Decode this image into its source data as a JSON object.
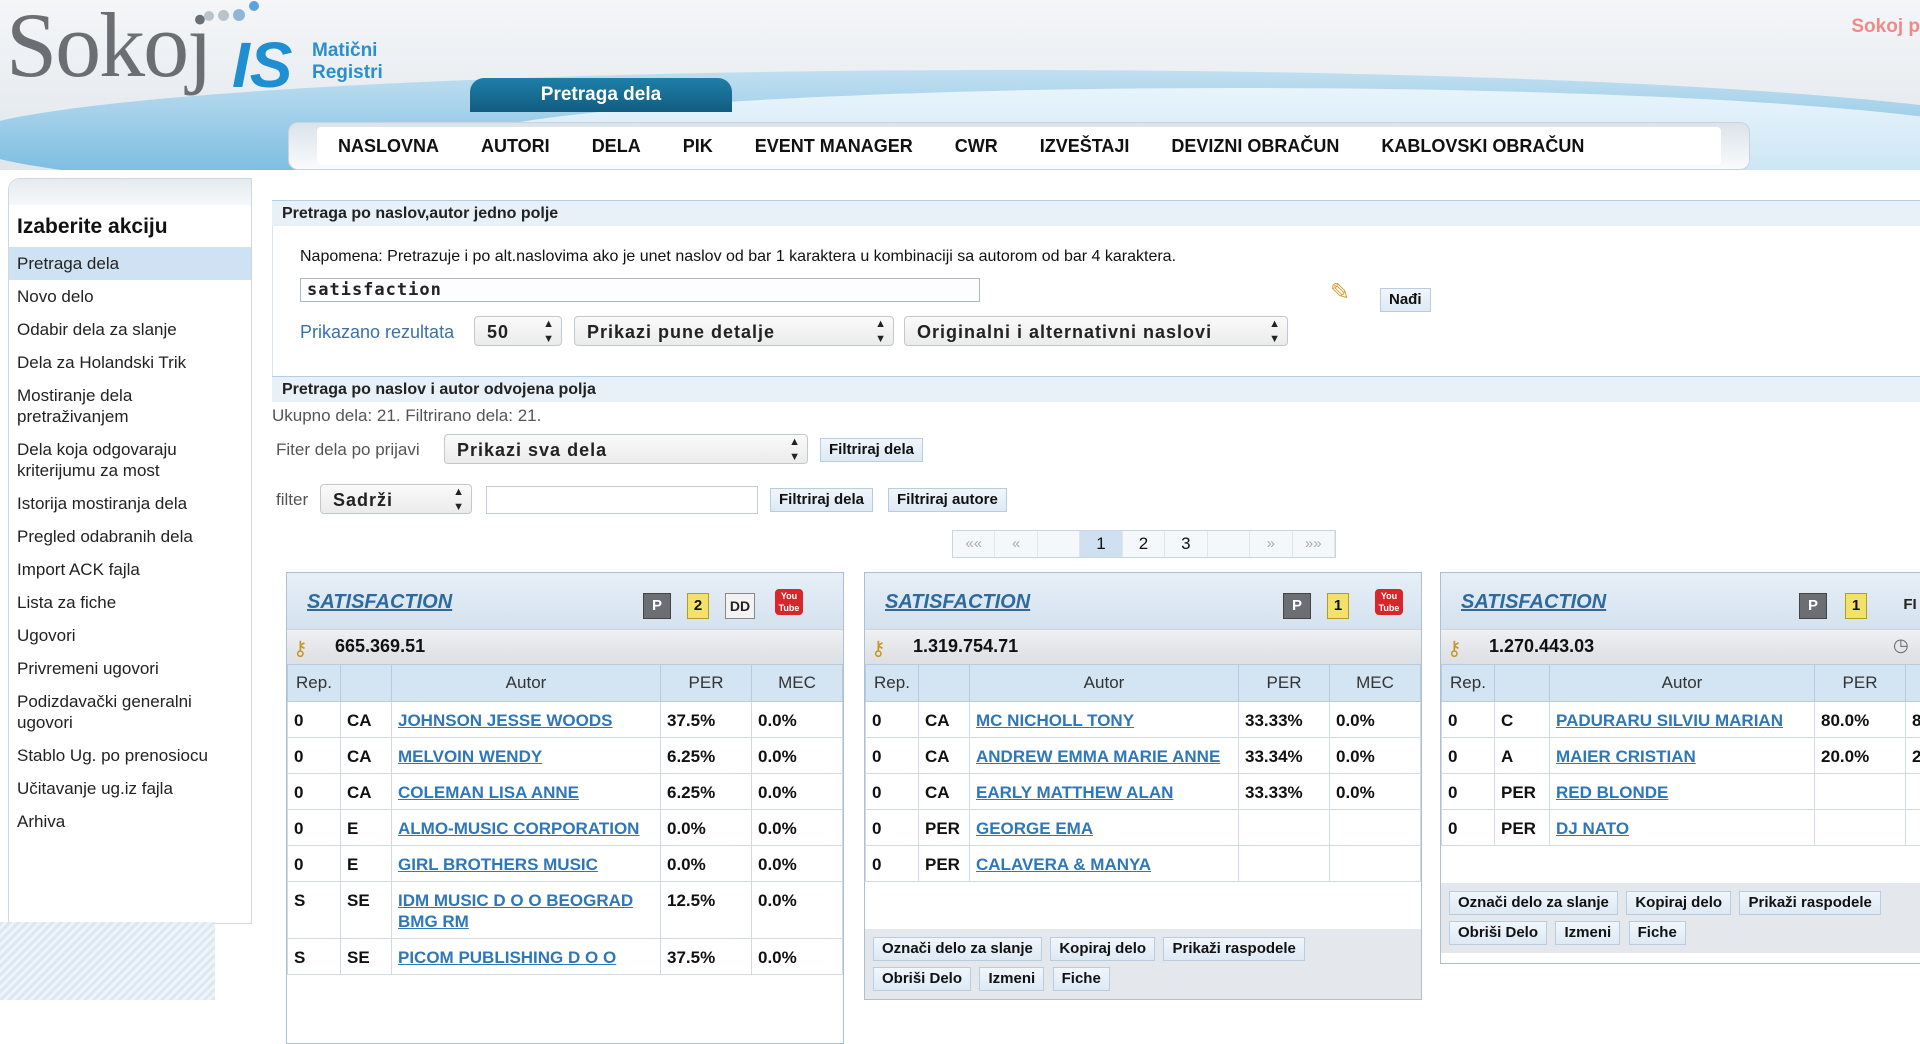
{
  "header": {
    "logo_text": "Sokoj",
    "logo_is": "IS",
    "logo_sub1": "Matični",
    "logo_sub2": "Registri",
    "top_right": "Sokoj p",
    "active_tab": "Pretraga dela"
  },
  "nav": [
    "NASLOVNA",
    "AUTORI",
    "DELA",
    "PIK",
    "EVENT MANAGER",
    "CWR",
    "IZVEŠTAJI",
    "DEVIZNI OBRAČUN",
    "KABLOVSKI OBRAČUN"
  ],
  "sidebar": {
    "title": "Izaberite akciju",
    "items": [
      "Pretraga dela",
      "Novo delo",
      "Odabir dela za slanje",
      "Dela za Holandski Trik",
      "Mostiranje dela pretraživanjem",
      "Dela koja odgovaraju kriterijumu za most",
      "Istorija mostiranja dela",
      "Pregled odabranih dela",
      "Import ACK fajla",
      "Lista za fiche",
      "Ugovori",
      "Privremeni ugovori",
      "Podizdavački generalni ugovori",
      "Stablo Ug. po prenosiocu",
      "Učitavanje ug.iz fajla",
      "Arhiva"
    ]
  },
  "search1": {
    "section_title": "Pretraga po naslov,autor jedno polje",
    "note": "Napomena: Pretrazuje i po alt.naslovima ako je unet naslov od bar 1 karaktera u kombinaciji sa autorom od bar 4 karaktera.",
    "query": "satisfaction",
    "find_button": "Nađi",
    "results_label": "Prikazano rezultata",
    "results_count": "50",
    "detail_select": "Prikazi pune detalje",
    "titles_select": "Originalni i alternativni naslovi"
  },
  "search2": {
    "section_title": "Pretraga po naslov i autor odvojena polja",
    "totals": "Ukupno dela: 21. Filtrirano dela: 21.",
    "filter_prijavi_label": "Fiter dela po prijavi",
    "filter_prijavi_value": "Prikazi sva dela",
    "filter_button": "Filtriraj dela",
    "filter_label": "filter",
    "filter_mode": "Sadrži",
    "filter_input_value": "",
    "filter_works_button": "Filtriraj dela",
    "filter_authors_button": "Filtriraj autore"
  },
  "pager": {
    "first": "««",
    "prev": "«",
    "pages": [
      "1",
      "2",
      "3"
    ],
    "next": "»",
    "last": "»»",
    "current": "1"
  },
  "icons": {
    "p": "P",
    "dd": "DD",
    "youtube": "You Tube",
    "fi": "FI",
    "key": "key-icon",
    "broom": "broom-icon",
    "clock": "clock-icon"
  },
  "table_headers": [
    "Rep.",
    "",
    "Autor",
    "PER",
    "MEC"
  ],
  "cards": [
    {
      "title": "SATISFACTION",
      "badge": "2",
      "value": "665.369.51",
      "rows": [
        [
          "0",
          "CA",
          "JOHNSON JESSE WOODS",
          "37.5%",
          "0.0%"
        ],
        [
          "0",
          "CA",
          "MELVOIN WENDY",
          "6.25%",
          "0.0%"
        ],
        [
          "0",
          "CA",
          "COLEMAN LISA ANNE",
          "6.25%",
          "0.0%"
        ],
        [
          "0",
          "E",
          "ALMO-MUSIC CORPORATION",
          "0.0%",
          "0.0%"
        ],
        [
          "0",
          "E",
          "GIRL BROTHERS MUSIC",
          "0.0%",
          "0.0%"
        ],
        [
          "S",
          "SE",
          "IDM MUSIC D O O BEOGRAD BMG RM",
          "12.5%",
          "0.0%"
        ],
        [
          "S",
          "SE",
          "PICOM PUBLISHING D O O",
          "37.5%",
          "0.0%"
        ]
      ]
    },
    {
      "title": "SATISFACTION",
      "badge": "1",
      "value": "1.319.754.71",
      "rows": [
        [
          "0",
          "CA",
          "MC NICHOLL TONY",
          "33.33%",
          "0.0%"
        ],
        [
          "0",
          "CA",
          "ANDREW EMMA MARIE ANNE",
          "33.34%",
          "0.0%"
        ],
        [
          "0",
          "CA",
          "EARLY MATTHEW ALAN",
          "33.33%",
          "0.0%"
        ],
        [
          "0",
          "PER",
          "GEORGE EMA",
          "",
          ""
        ],
        [
          "0",
          "PER",
          "CALAVERA & MANYA",
          "",
          ""
        ]
      ],
      "actions": [
        "Označi delo za slanje",
        "Kopiraj delo",
        "Prikaži raspodele",
        "Obriši Delo",
        "Izmeni",
        "Fiche"
      ]
    },
    {
      "title": "SATISFACTION",
      "badge": "1",
      "value": "1.270.443.03",
      "rows": [
        [
          "0",
          "C",
          "PADURARU SILVIU MARIAN",
          "80.0%",
          "8"
        ],
        [
          "0",
          "A",
          "MAIER CRISTIAN",
          "20.0%",
          "2"
        ],
        [
          "0",
          "PER",
          "RED BLONDE",
          "",
          ""
        ],
        [
          "0",
          "PER",
          "DJ NATO",
          "",
          ""
        ]
      ],
      "actions": [
        "Označi delo za slanje",
        "Kopiraj delo",
        "Prikaži raspodele",
        "Obriši Delo",
        "Izmeni",
        "Fiche"
      ]
    }
  ]
}
